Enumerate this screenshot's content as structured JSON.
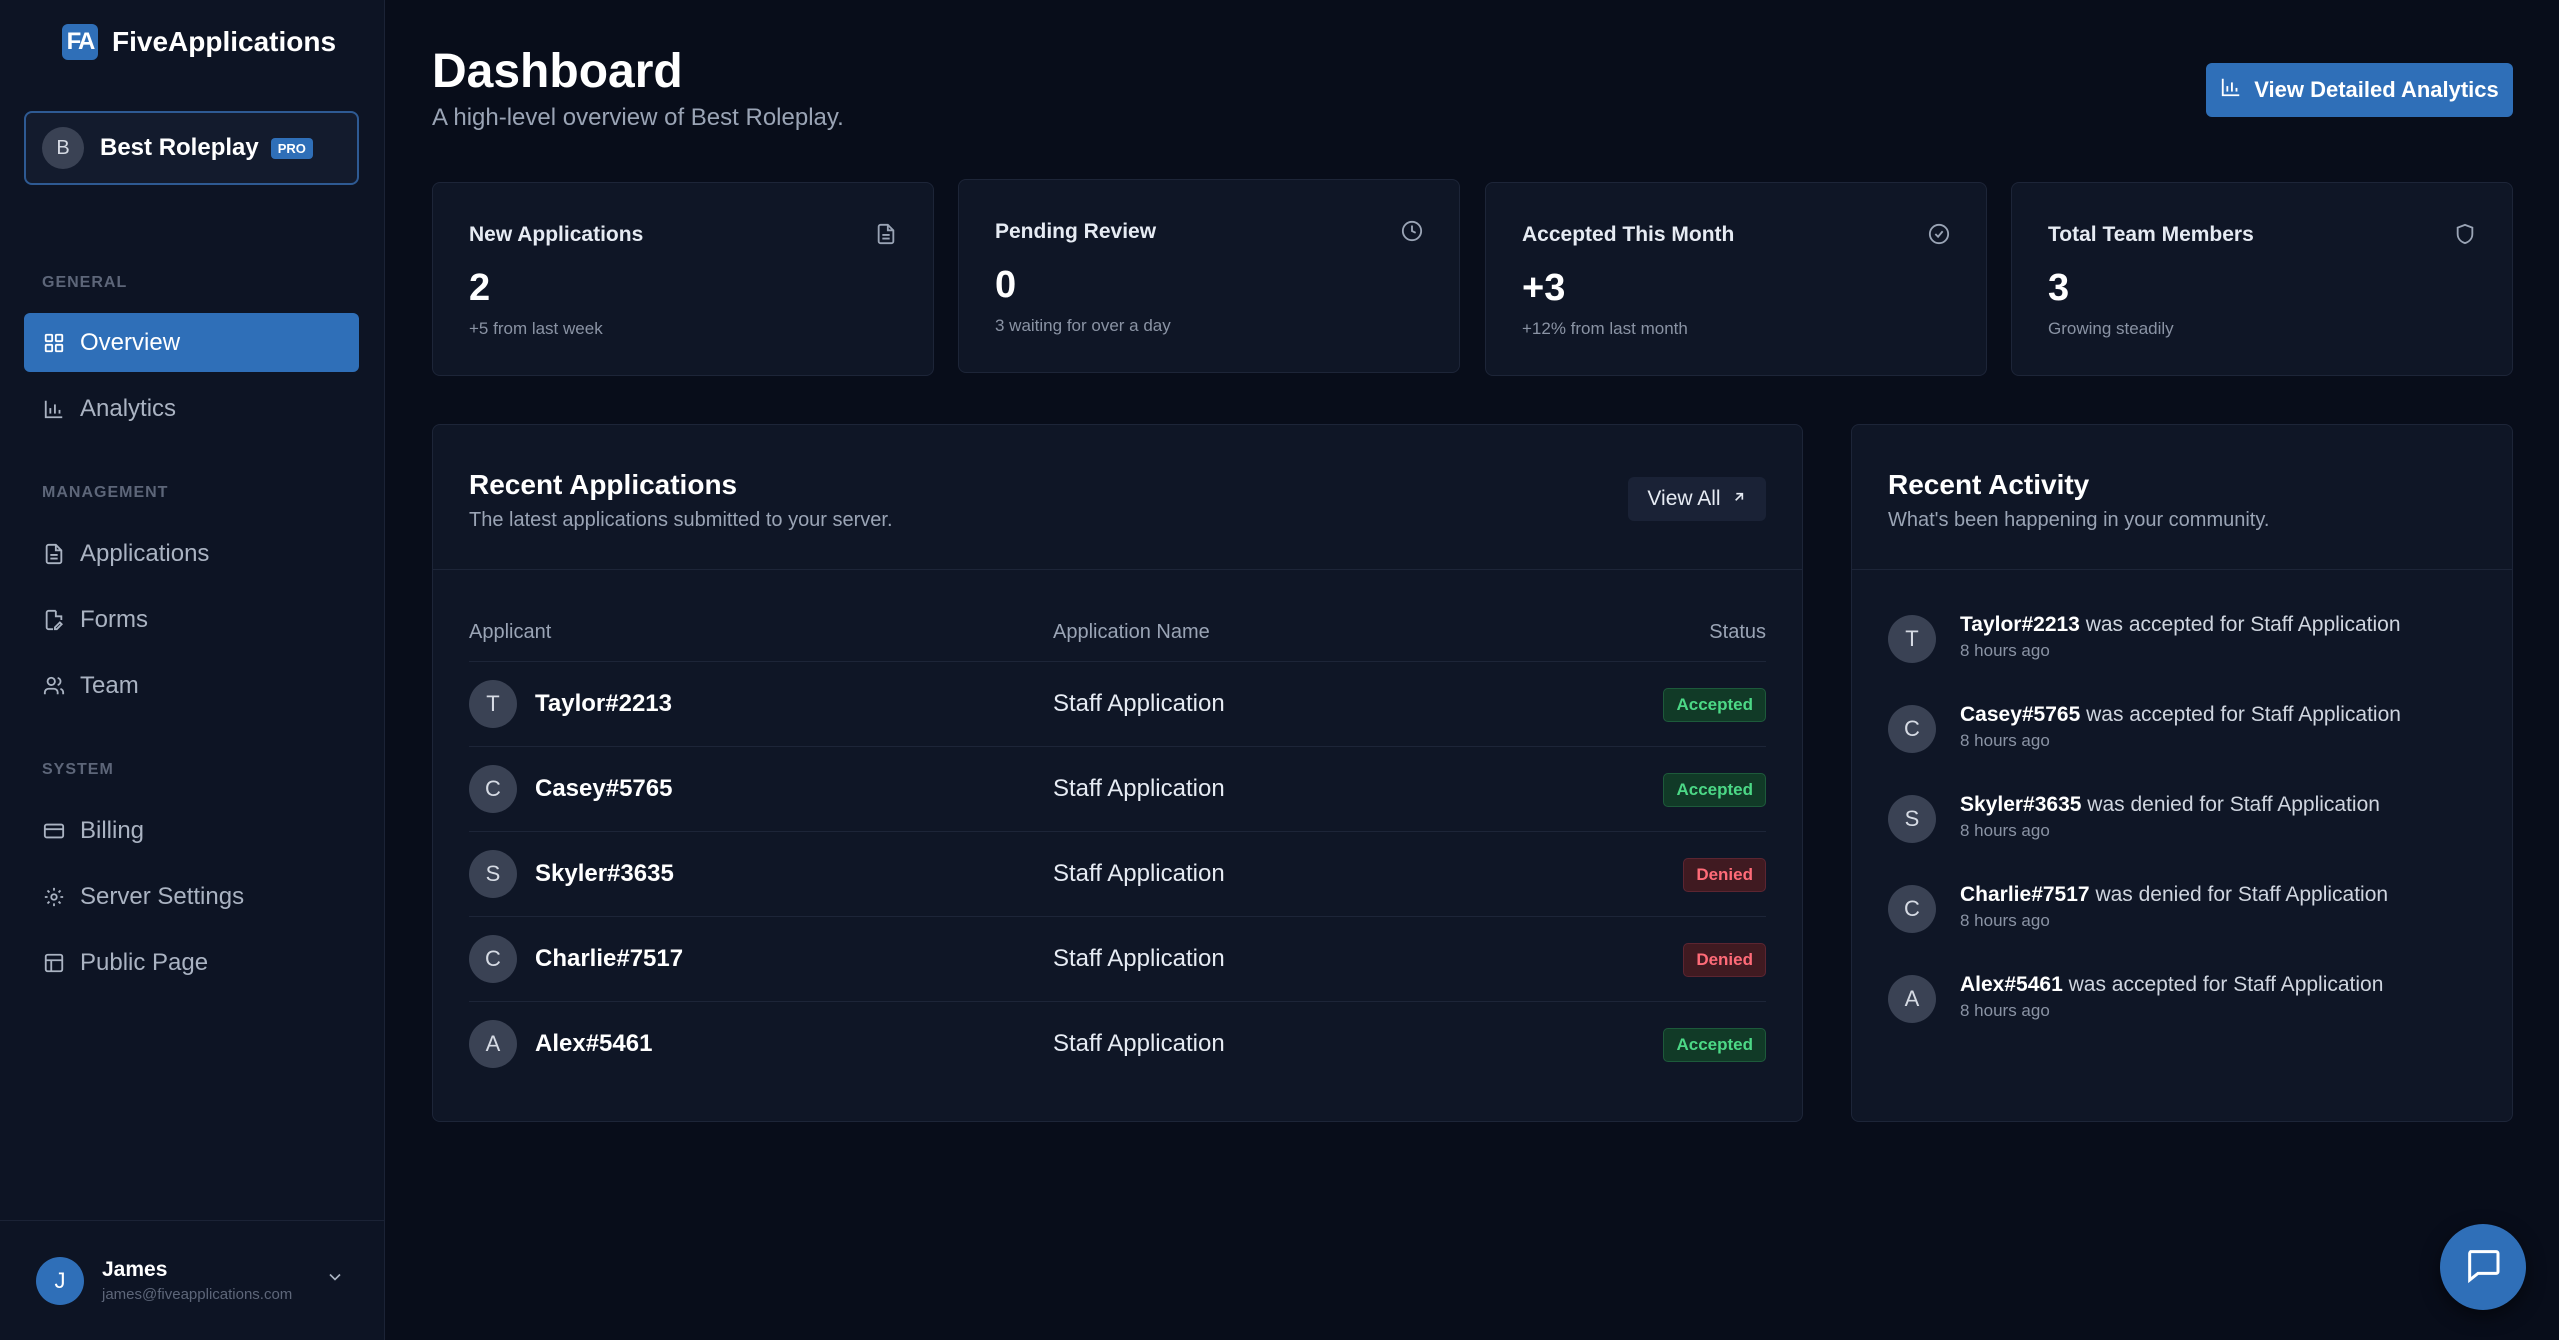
{
  "brand": {
    "logo": "FA",
    "name": "FiveApplications"
  },
  "server": {
    "initial": "B",
    "name": "Best Roleplay",
    "badge": "PRO"
  },
  "sidebar": {
    "sections": [
      {
        "label": "GENERAL"
      },
      {
        "label": "MANAGEMENT"
      },
      {
        "label": "SYSTEM"
      }
    ],
    "items": [
      {
        "label": "Overview",
        "icon": "grid-icon",
        "active": true
      },
      {
        "label": "Analytics",
        "icon": "bar-chart-icon"
      },
      {
        "label": "Applications",
        "icon": "document-icon"
      },
      {
        "label": "Forms",
        "icon": "form-edit-icon"
      },
      {
        "label": "Team",
        "icon": "users-icon"
      },
      {
        "label": "Billing",
        "icon": "credit-card-icon"
      },
      {
        "label": "Server Settings",
        "icon": "gear-icon"
      },
      {
        "label": "Public Page",
        "icon": "layout-icon"
      }
    ]
  },
  "user": {
    "initial": "J",
    "name": "James",
    "email": "james@fiveapplications.com"
  },
  "header": {
    "title": "Dashboard",
    "subtitle": "A high-level overview of Best Roleplay.",
    "analytics_button": "View Detailed Analytics"
  },
  "stats": [
    {
      "title": "New Applications",
      "value": "2",
      "note": "+5 from last week",
      "icon": "document-icon"
    },
    {
      "title": "Pending Review",
      "value": "0",
      "note": "3 waiting for over a day",
      "icon": "clock-icon"
    },
    {
      "title": "Accepted This Month",
      "value": "+3",
      "note": "+12% from last month",
      "icon": "check-circle-icon"
    },
    {
      "title": "Total Team Members",
      "value": "3",
      "note": "Growing steadily",
      "icon": "shield-icon"
    }
  ],
  "recent_applications": {
    "title": "Recent Applications",
    "subtitle": "The latest applications submitted to your server.",
    "view_all": "View All",
    "columns": [
      "Applicant",
      "Application Name",
      "Status"
    ],
    "rows": [
      {
        "initial": "T",
        "applicant": "Taylor#2213",
        "application": "Staff Application",
        "status": "Accepted"
      },
      {
        "initial": "C",
        "applicant": "Casey#5765",
        "application": "Staff Application",
        "status": "Accepted"
      },
      {
        "initial": "S",
        "applicant": "Skyler#3635",
        "application": "Staff Application",
        "status": "Denied"
      },
      {
        "initial": "C",
        "applicant": "Charlie#7517",
        "application": "Staff Application",
        "status": "Denied"
      },
      {
        "initial": "A",
        "applicant": "Alex#5461",
        "application": "Staff Application",
        "status": "Accepted"
      }
    ]
  },
  "recent_activity": {
    "title": "Recent Activity",
    "subtitle": "What's been happening in your community.",
    "items": [
      {
        "initial": "T",
        "user": "Taylor#2213",
        "action": "was accepted for Staff Application",
        "time": "8 hours ago"
      },
      {
        "initial": "C",
        "user": "Casey#5765",
        "action": "was accepted for Staff Application",
        "time": "8 hours ago"
      },
      {
        "initial": "S",
        "user": "Skyler#3635",
        "action": "was denied for Staff Application",
        "time": "8 hours ago"
      },
      {
        "initial": "C",
        "user": "Charlie#7517",
        "action": "was denied for Staff Application",
        "time": "8 hours ago"
      },
      {
        "initial": "A",
        "user": "Alex#5461",
        "action": "was accepted for Staff Application",
        "time": "8 hours ago"
      }
    ]
  },
  "colors": {
    "accent": "#2f6fb8",
    "accepted": "#4cd886",
    "denied": "#ff6b78",
    "background": "#080d1a"
  }
}
